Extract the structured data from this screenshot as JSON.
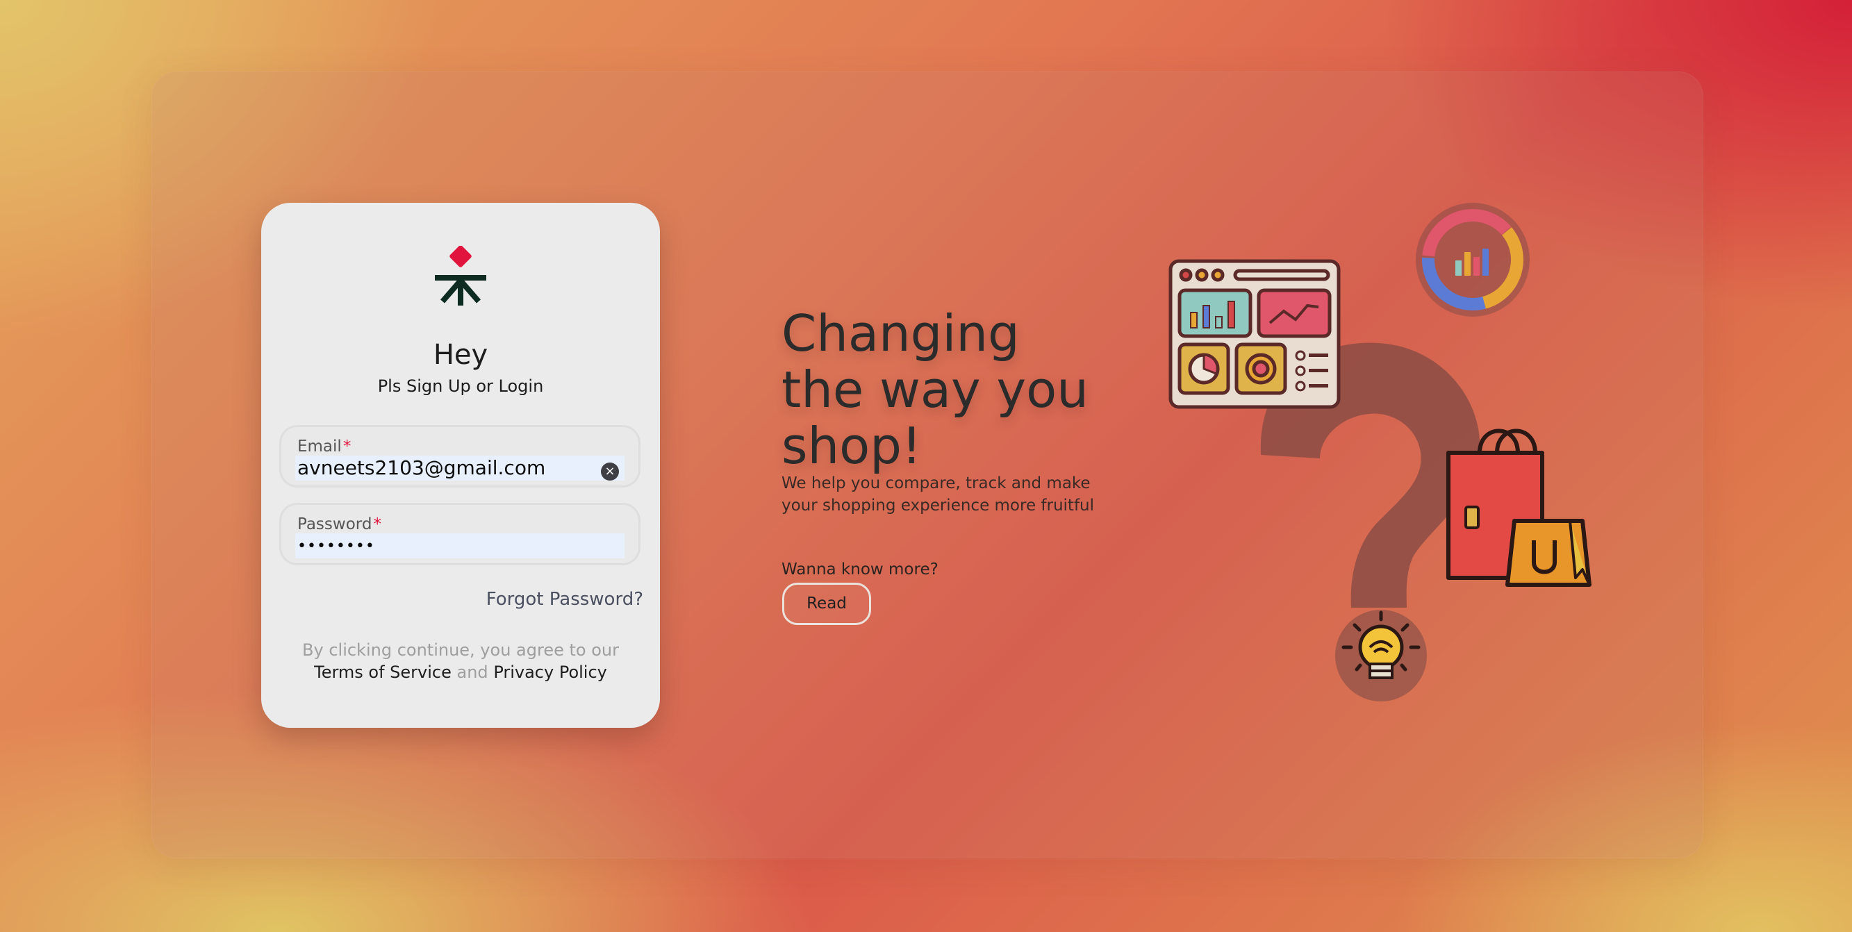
{
  "login_card": {
    "greeting": "Hey",
    "subtitle": "Pls Sign Up or Login",
    "email": {
      "label": "Email",
      "required_mark": "*",
      "value": "avneets2103@gmail.com",
      "clear_icon": "×"
    },
    "password": {
      "label": "Password",
      "required_mark": "*",
      "value": "••••••••"
    },
    "forgot_password": "Forgot Password?",
    "terms": {
      "prefix": "By clicking continue, you agree to our",
      "terms_link": "Terms of Service",
      "conjunction": "and",
      "privacy_link": "Privacy Policy"
    }
  },
  "hero": {
    "headline": "Changing\nthe way you\nshop!",
    "description": "We help you compare, track and make your shopping experience more fruitful",
    "prompt": "Wanna know more?",
    "read_button": "Read"
  },
  "icons": [
    "logo-icon",
    "dashboard-icon",
    "donut-chart-icon",
    "question-mark-icon",
    "shopping-bags-icon",
    "lightbulb-icon",
    "clear-icon"
  ],
  "colors": {
    "accent_red": "#e0143c",
    "logo_dark": "#0e2b22",
    "card_background": "#ebebeb"
  }
}
